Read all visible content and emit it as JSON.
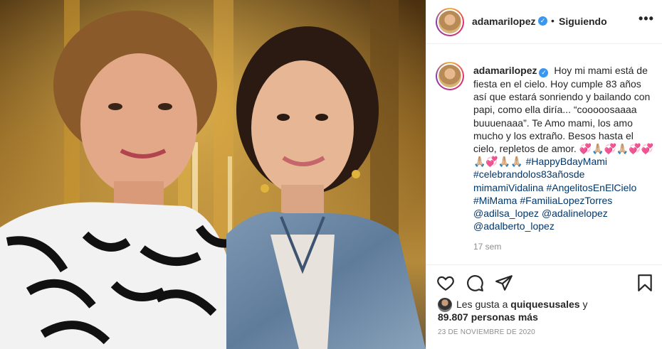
{
  "post": {
    "username": "adamarilopez",
    "verified_glyph": "✓",
    "separator": "•",
    "follow_status": "Siguiendo",
    "more_glyph": "•••"
  },
  "caption": {
    "username": "adamarilopez",
    "body": "Hoy mi mami está de fiesta en el cielo. Hoy cumple 83 años así que estará sonriendo y bailando con papi, como ella diría... “cooooosaaaa buuuenaaa”. Te Amo mami, los amo mucho y los extraño. Besos hasta el cielo, repletos de amor. 💞🙏🏼💞🙏🏼💞💞🙏🏼💞🙏🏼🙏🏼",
    "hashtags": [
      "#HappyBdayMami",
      "#celebrandolos83añosde",
      "mimamiVidalina",
      "#AngelitosEnElCielo",
      "#MiMama",
      "#FamiliaLopezTorres"
    ],
    "mentions": [
      "@adilsa_lopez",
      "@adalinelopez",
      "@adalberto_lopez"
    ],
    "time_ago": "17 sem"
  },
  "actions": {
    "icons": [
      "heart-icon",
      "comment-icon",
      "share-icon",
      "bookmark-icon"
    ]
  },
  "likes": {
    "prefix": "Les gusta a",
    "user": "quiquesusales",
    "connector": "y",
    "count_text": "89.807 personas más"
  },
  "date": "23 DE NOVIEMBRE DE 2020",
  "colors": {
    "link": "#00376b",
    "verified": "#3897f0",
    "muted": "#8e8e8e",
    "border": "#efefef"
  }
}
